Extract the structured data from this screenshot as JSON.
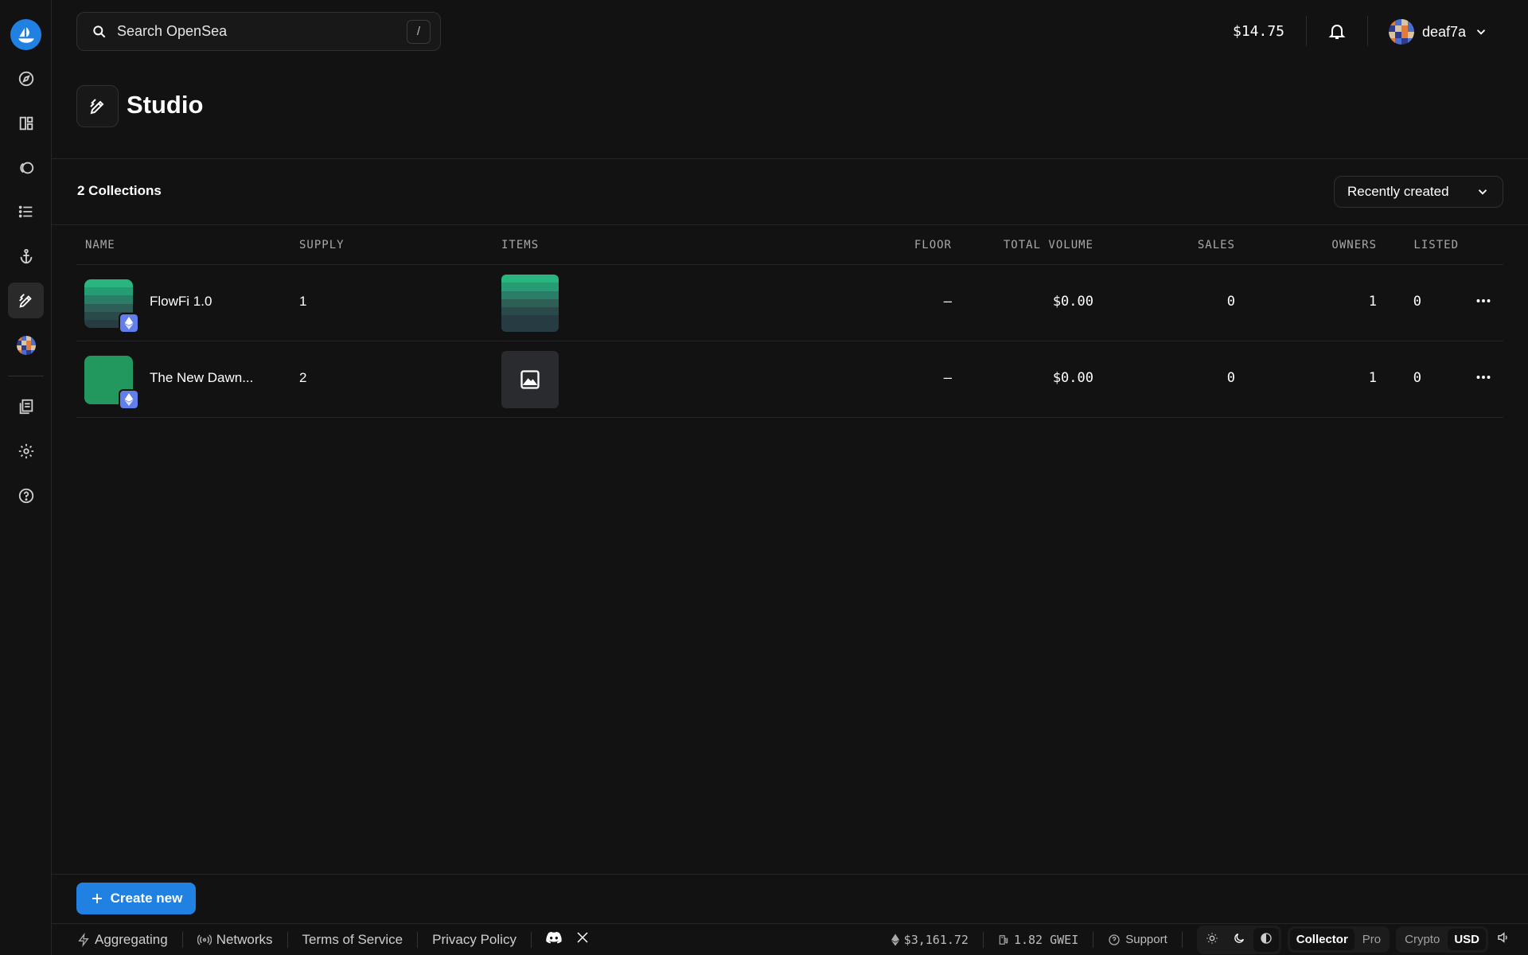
{
  "header": {
    "search_placeholder": "Search OpenSea",
    "search_shortcut": "/",
    "balance": "$14.75",
    "account_name": "deaf7a"
  },
  "page": {
    "title": "Studio",
    "collections_count": "2 Collections",
    "sort_label": "Recently created"
  },
  "table": {
    "columns": [
      "NAME",
      "SUPPLY",
      "ITEMS",
      "FLOOR",
      "TOTAL VOLUME",
      "SALES",
      "OWNERS",
      "LISTED"
    ],
    "rows": [
      {
        "name": "FlowFi 1.0",
        "supply": "1",
        "floor": "—",
        "volume": "$0.00",
        "sales": "0",
        "owners": "1",
        "listed": "0"
      },
      {
        "name": "The New Dawn...",
        "supply": "2",
        "floor": "—",
        "volume": "$0.00",
        "sales": "0",
        "owners": "1",
        "listed": "0"
      }
    ]
  },
  "actions": {
    "create_label": "Create new"
  },
  "footer": {
    "aggregating": "Aggregating",
    "networks": "Networks",
    "terms": "Terms of Service",
    "privacy": "Privacy Policy",
    "eth_price": "$3,161.72",
    "gas": "1.82 GWEI",
    "support": "Support",
    "mode_collector": "Collector",
    "mode_pro": "Pro",
    "currency_crypto": "Crypto",
    "currency_usd": "USD"
  },
  "colors": {
    "accent": "#2081e2",
    "eth_badge": "#627eea",
    "background": "#121212"
  }
}
